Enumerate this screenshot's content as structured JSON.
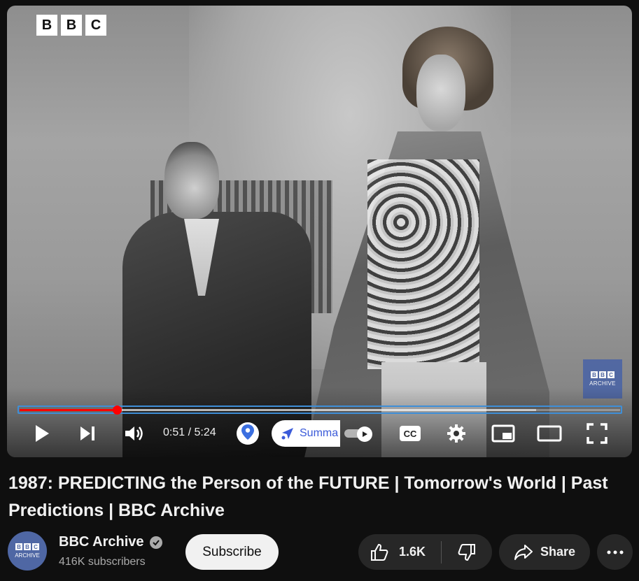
{
  "player": {
    "bbc_logo_letters": [
      "B",
      "B",
      "C"
    ],
    "watermark": {
      "letters": [
        "B",
        "B",
        "C"
      ],
      "text": "ARCHIVE"
    },
    "progress": {
      "played_fraction": 0.162,
      "buffered_fraction": 0.86
    },
    "time_display": "0:51 / 5:24",
    "summary_chip_label": "Summa",
    "icons": {
      "play": "play-icon",
      "next": "skip-next-icon",
      "volume": "volume-icon",
      "location": "location-pin-icon",
      "summary": "sparkle-icon",
      "autoplay": "autoplay-toggle-icon",
      "captions": "closed-captions-icon",
      "settings": "gear-icon",
      "miniplayer": "miniplayer-icon",
      "theater": "theater-mode-icon",
      "fullscreen": "fullscreen-icon"
    }
  },
  "video": {
    "title": "1987: PREDICTING the Person of the FUTURE | Tomorrow's World | Past Predictions | BBC Archive"
  },
  "channel": {
    "avatar": {
      "letters": [
        "B",
        "B",
        "C"
      ],
      "text": "ARCHIVE"
    },
    "name": "BBC Archive",
    "subscribers": "416K subscribers",
    "subscribe_label": "Subscribe"
  },
  "actions": {
    "like_count": "1.6K",
    "share_label": "Share"
  },
  "colors": {
    "background": "#0f0f0f",
    "progress_played": "#ff0000",
    "bbc_archive_blue": "#4f67a4",
    "pill_background": "#272727",
    "summary_text": "#3b5bd9"
  }
}
